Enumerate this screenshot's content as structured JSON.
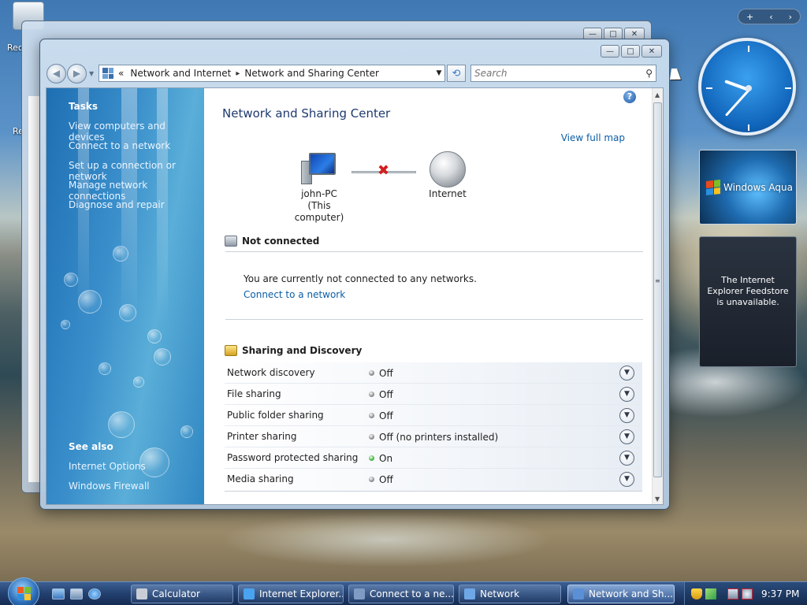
{
  "desktop": {
    "recycle_label_1": "Rec",
    "recycle_label_2": "Re"
  },
  "window": {
    "title_controls": {
      "minimize": "—",
      "maximize": "□",
      "close": "✕"
    },
    "breadcrumb": {
      "root_chevron": "«",
      "segment_1": "Network and Internet",
      "separator": "▸",
      "segment_2": "Network and Sharing Center"
    },
    "search_placeholder": "Search"
  },
  "sidebar": {
    "tasks_heading": "Tasks",
    "tasks": [
      "View computers and devices",
      "Connect to a network",
      "Set up a connection or network",
      "Manage network connections",
      "Diagnose and repair"
    ],
    "see_also_heading": "See also",
    "see_also": [
      "Internet Options",
      "Windows Firewall"
    ]
  },
  "main": {
    "title": "Network and Sharing Center",
    "view_full_map": "View full map",
    "help_glyph": "?",
    "map": {
      "computer_name": "john-PC",
      "computer_caption": "(This computer)",
      "internet_label": "Internet",
      "broken_link_glyph": "✖"
    },
    "not_connected": {
      "heading": "Not connected",
      "message": "You are currently not connected to any networks.",
      "link": "Connect to a network"
    },
    "sharing": {
      "heading": "Sharing and Discovery",
      "rows": [
        {
          "label": "Network discovery",
          "status": "Off",
          "dot": "#8a8a8a"
        },
        {
          "label": "File sharing",
          "status": "Off",
          "dot": "#8a8a8a"
        },
        {
          "label": "Public folder sharing",
          "status": "Off",
          "dot": "#8a8a8a"
        },
        {
          "label": "Printer sharing",
          "status": "Off (no printers installed)",
          "dot": "#8a8a8a"
        },
        {
          "label": "Password protected sharing",
          "status": "On",
          "dot": "#3cb43c"
        },
        {
          "label": "Media sharing",
          "status": "Off",
          "dot": "#8a8a8a"
        }
      ]
    }
  },
  "gadgets": {
    "toolbar": {
      "add": "+",
      "prev": "‹",
      "next": "›"
    },
    "slideshow_text": "Windows Aqua",
    "feed_message": "The Internet Explorer Feedstore is unavailable."
  },
  "taskbar": {
    "tasks": [
      {
        "label": "Calculator",
        "color": "#c9ced6"
      },
      {
        "label": "Internet Explorer...",
        "color": "#4aa3f0"
      },
      {
        "label": "Connect to a ne...",
        "color": "#7f9bc4"
      },
      {
        "label": "Network",
        "color": "#6ea7e6"
      },
      {
        "label": "Network and Sh...",
        "color": "#5b8fd6"
      }
    ],
    "clock": "9:37 PM"
  },
  "colors": {
    "link": "#0b5ea6",
    "title_text": "#1e3a6e",
    "status_on": "#3cb43c",
    "status_off": "#8a8a8a",
    "error_x": "#d21e1e"
  }
}
